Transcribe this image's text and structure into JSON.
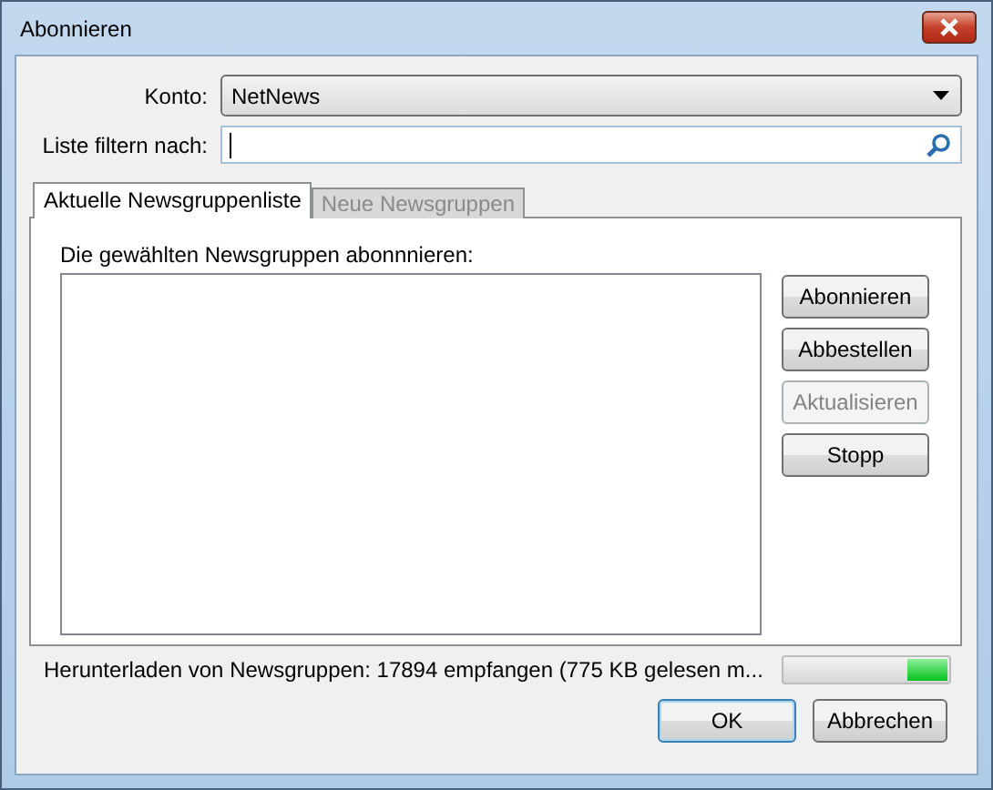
{
  "window": {
    "title": "Abonnieren"
  },
  "account": {
    "label": "Konto:",
    "value": "NetNews"
  },
  "filter": {
    "label": "Liste filtern nach:"
  },
  "tabs": [
    {
      "label": "Aktuelle Newsgruppenliste",
      "selected": true,
      "disabled": false
    },
    {
      "label": "Neue Newsgruppen",
      "selected": false,
      "disabled": true
    }
  ],
  "list": {
    "label": "Die gewählten Newsgruppen abonnnieren:"
  },
  "actions": [
    {
      "label": "Abonnieren",
      "disabled": false
    },
    {
      "label": "Abbestellen",
      "disabled": false
    },
    {
      "label": "Aktualisieren",
      "disabled": true
    },
    {
      "label": "Stopp",
      "disabled": false
    }
  ],
  "status_bar": {
    "text": "Herunterladen von Newsgruppen: 17894 empfangen (775 KB gelesen m...",
    "busy": true
  },
  "buttons": [
    {
      "label": "OK",
      "default": true
    },
    {
      "label": "Abbrechen",
      "default": false
    }
  ]
}
